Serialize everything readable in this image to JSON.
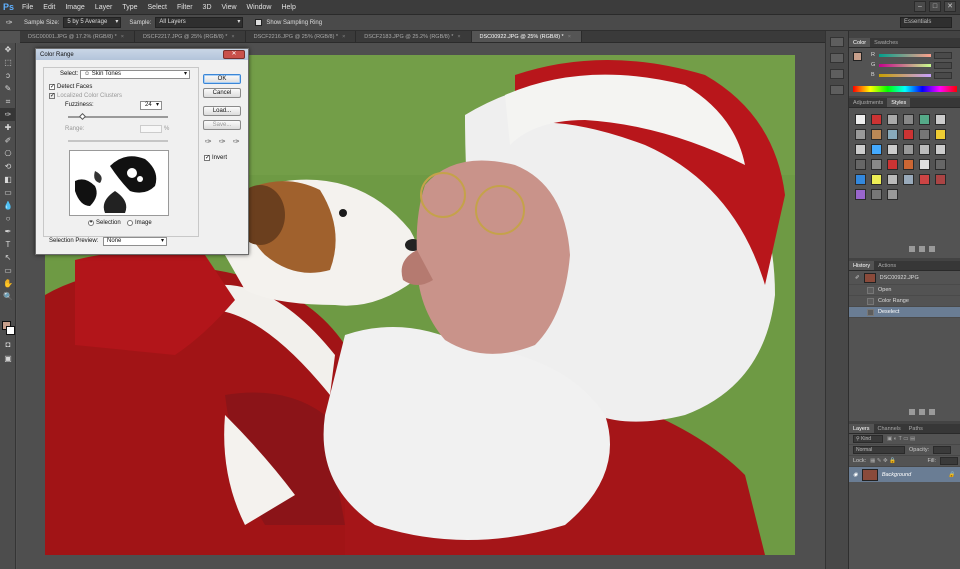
{
  "app": {
    "logo": "Ps"
  },
  "menu": [
    "File",
    "Edit",
    "Image",
    "Layer",
    "Type",
    "Select",
    "Filter",
    "3D",
    "View",
    "Window",
    "Help"
  ],
  "options_bar": {
    "sample_size_label": "Sample Size:",
    "sample_size_value": "5 by 5 Average",
    "sample_label": "Sample:",
    "sample_value": "All Layers",
    "show_ring_label": "Show Sampling Ring",
    "workspace": "Essentials"
  },
  "tabs": [
    {
      "label": "DSC00001.JPG @ 17.2% (RGB/8) *",
      "active": false
    },
    {
      "label": "DSCF2217.JPG @ 25% (RGB/8) *",
      "active": false
    },
    {
      "label": "DSCF2216.JPG @ 25% (RGB/8) *",
      "active": false
    },
    {
      "label": "DSCF2183.JPG @ 25.2% (RGB/8) *",
      "active": false
    },
    {
      "label": "DSC00922.JPG @ 25% (RGB/8) *",
      "active": true
    }
  ],
  "tools": [
    "move-icon",
    "marquee-icon",
    "lasso-icon",
    "quick-select-icon",
    "crop-icon",
    "eyedropper-icon",
    "healing-icon",
    "brush-icon",
    "clone-stamp-icon",
    "history-brush-icon",
    "eraser-icon",
    "gradient-icon",
    "blur-icon",
    "dodge-icon",
    "pen-icon",
    "type-icon",
    "path-select-icon",
    "shape-icon",
    "hand-icon",
    "zoom-icon"
  ],
  "tool_glyphs": [
    "✥",
    "⬚",
    "ↄ",
    "✎",
    "⌗",
    "✑",
    "✚",
    "✐",
    "⎔",
    "⟲",
    "◧",
    "▭",
    "💧",
    "○",
    "✒",
    "T",
    "↖",
    "▭",
    "✋",
    "🔍"
  ],
  "colors": {
    "foreground": "#c8a08c",
    "background": "#ffffff",
    "accent_selection": "#6a7d94"
  },
  "dialog": {
    "title": "Color Range",
    "select_label": "Select:",
    "select_value": "Skin Tones",
    "detect_faces": "Detect Faces",
    "detect_faces_checked": true,
    "localized": "Localized Color Clusters",
    "fuzziness_label": "Fuzziness:",
    "fuzziness_value": "24",
    "range_label": "Range:",
    "range_unit": "%",
    "radio_selection": "Selection",
    "radio_image": "Image",
    "preview_label": "Selection Preview:",
    "preview_value": "None",
    "ok": "OK",
    "cancel": "Cancel",
    "load": "Load...",
    "save": "Save...",
    "invert": "Invert",
    "invert_checked": true
  },
  "color_panel": {
    "tabs": [
      "Color",
      "Swatches"
    ],
    "channels": [
      "R",
      "G",
      "B"
    ]
  },
  "styles_panel": {
    "tabs": [
      "Adjustments",
      "Styles"
    ]
  },
  "history_panel": {
    "tabs": [
      "History",
      "Actions"
    ],
    "snapshot": "DSC00922.JPG",
    "steps": [
      "Open",
      "Color Range",
      "Deselect"
    ]
  },
  "layers_panel": {
    "tabs": [
      "Layers",
      "Channels",
      "Paths"
    ],
    "kind": "Kind",
    "blend": "Normal",
    "opacity_label": "Opacity:",
    "lock_label": "Lock:",
    "fill_label": "Fill:",
    "layer_name": "Background"
  }
}
